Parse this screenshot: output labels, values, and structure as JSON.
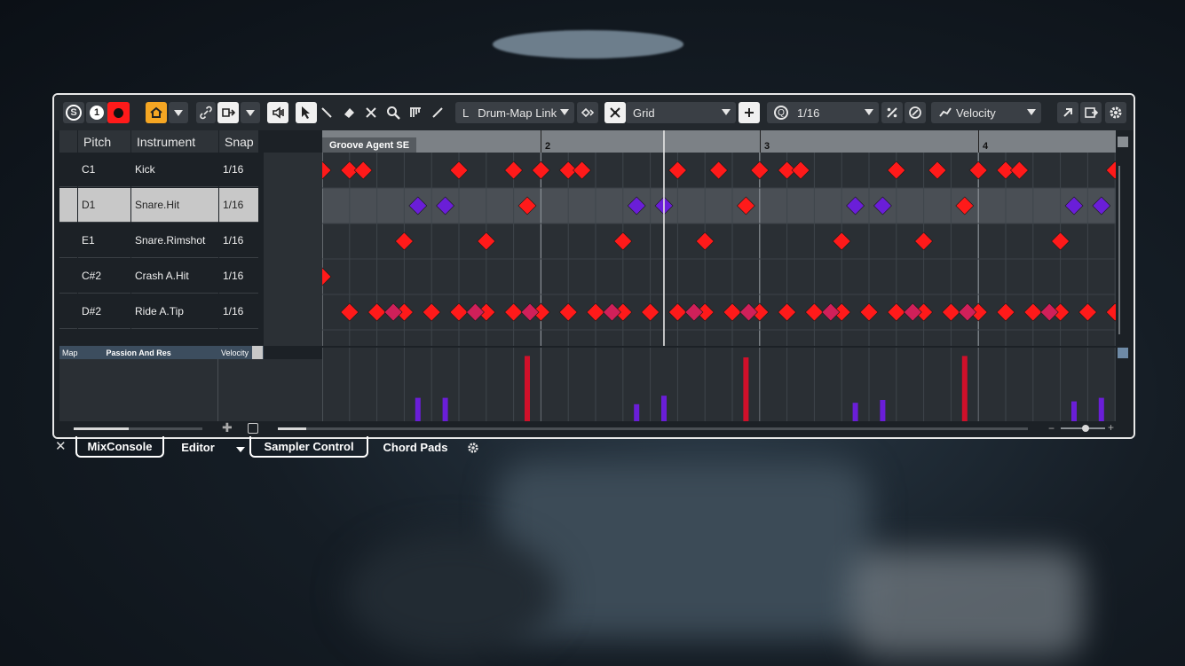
{
  "toolbar": {
    "solo_label": "S",
    "one_label": "1",
    "drum_map_link_label": "Drum-Map Link",
    "grid_label": "Grid",
    "quantize_label": "Q",
    "quantize_value": "1/16",
    "velocity_label": "Velocity",
    "lane_prefix": "L"
  },
  "columns": {
    "pitch": "Pitch",
    "instrument": "Instrument",
    "snap": "Snap"
  },
  "ruler": {
    "part_name": "Groove Agent SE",
    "bar2": "2",
    "bar3": "3",
    "bar4": "4"
  },
  "instruments": [
    {
      "pitch": "C1",
      "instrument": "Kick",
      "snap": "1/16"
    },
    {
      "pitch": "D1",
      "instrument": "Snare.Hit",
      "snap": "1/16"
    },
    {
      "pitch": "E1",
      "instrument": "Snare.Rimshot",
      "snap": "1/16"
    },
    {
      "pitch": "C#2",
      "instrument": "Crash A.Hit",
      "snap": "1/16"
    },
    {
      "pitch": "D#2",
      "instrument": "Ride A.Tip",
      "snap": "1/16"
    }
  ],
  "controller": {
    "map_label": "Map",
    "map_name": "Passion And Res",
    "lane_label": "Velocity"
  },
  "tabs": {
    "mixconsole": "MixConsole",
    "editor": "Editor",
    "sampler_control": "Sampler Control",
    "chord_pads": "Chord Pads"
  },
  "colors": {
    "accent": "#f5a623",
    "note_red": "#ff1a1a",
    "note_purple": "#6a1ed8",
    "note_magenta": "#d0205a",
    "record": "#ff1a1a"
  },
  "chart_data": {
    "type": "scatter",
    "bar_ticks": [
      "2",
      "3",
      "4"
    ],
    "rows": [
      {
        "instrument": "Kick",
        "color": "#ff1a1a",
        "steps": [
          0,
          1,
          1.5,
          5,
          7,
          8,
          9,
          9.5,
          13,
          14.5,
          16,
          17,
          17.5,
          21,
          22.5,
          24,
          25,
          25.5,
          29
        ]
      },
      {
        "instrument": "Snare.Hit",
        "steps_purple": [
          3.5,
          4.5,
          11.5,
          12.5,
          19.5,
          20.5,
          27.5,
          28.5
        ],
        "steps_red": [
          7.5,
          15.5,
          23.5
        ]
      },
      {
        "instrument": "Snare.Rimshot",
        "color": "#ff1a1a",
        "steps": [
          3,
          6,
          11,
          14,
          19,
          22,
          27
        ]
      },
      {
        "instrument": "Crash A.Hit",
        "color": "#ff1a1a",
        "steps": [
          0
        ]
      },
      {
        "instrument": "Ride A.Tip",
        "color": "#ff1a1a",
        "steps": [
          1,
          2,
          3,
          4,
          5,
          6,
          7,
          8,
          9,
          10,
          11,
          12,
          13,
          14,
          15,
          16,
          17,
          18,
          19,
          20,
          21,
          22,
          23,
          24,
          25,
          26,
          27,
          28,
          29
        ],
        "steps_magenta": [
          2.6,
          5.6,
          7.6,
          10.6,
          13.6,
          15.6,
          18.6,
          21.6,
          23.6,
          26.6
        ]
      }
    ],
    "velocity_lane": [
      {
        "step": 3.5,
        "level": 0.33,
        "color": "#6a1ed8"
      },
      {
        "step": 4.5,
        "level": 0.33,
        "color": "#6a1ed8"
      },
      {
        "step": 7.5,
        "level": 0.92,
        "color": "#d0102a"
      },
      {
        "step": 11.5,
        "level": 0.24,
        "color": "#6a1ed8"
      },
      {
        "step": 12.5,
        "level": 0.36,
        "color": "#6a1ed8"
      },
      {
        "step": 15.5,
        "level": 0.9,
        "color": "#d0102a"
      },
      {
        "step": 19.5,
        "level": 0.26,
        "color": "#6a1ed8"
      },
      {
        "step": 20.5,
        "level": 0.3,
        "color": "#6a1ed8"
      },
      {
        "step": 23.5,
        "level": 0.92,
        "color": "#d0102a"
      },
      {
        "step": 27.5,
        "level": 0.28,
        "color": "#6a1ed8"
      },
      {
        "step": 28.5,
        "level": 0.33,
        "color": "#6a1ed8"
      }
    ]
  }
}
